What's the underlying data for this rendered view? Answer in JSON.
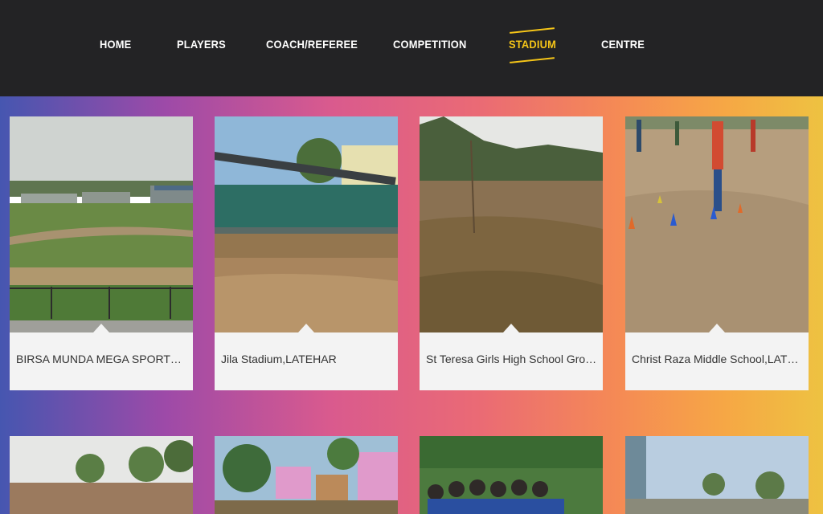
{
  "nav": {
    "items": [
      {
        "label": "HOME"
      },
      {
        "label": "PLAYERS"
      },
      {
        "label": "COACH/REFEREE"
      },
      {
        "label": "COMPETITION"
      },
      {
        "label": "STADIUM"
      },
      {
        "label": "CENTRE"
      }
    ],
    "active": "STADIUM",
    "accent_color": "#f5c518"
  },
  "stadiums": [
    {
      "name": "BIRSA MUNDA MEGA SPORTS COMPLEX,LATEHAR",
      "display": "BIRSA MUNDA MEGA SPORTS COM..."
    },
    {
      "name": "Jila Stadium,LATEHAR",
      "display": "Jila Stadium,LATEHAR"
    },
    {
      "name": "St Teresa Girls High School Ground,LATEHAR",
      "display": "St Teresa Girls High School Ground,..."
    },
    {
      "name": "Christ Raza Middle School,LATEHAR",
      "display": "Christ Raza Middle School,LATEHAR"
    }
  ],
  "colors": {
    "header_bg": "#232325",
    "caption_bg": "#f3f3f3",
    "gradient": [
      "#4656b0",
      "#9d4aa8",
      "#d95a8e",
      "#ea6a75",
      "#f58a55",
      "#f6a745",
      "#eec241"
    ]
  }
}
